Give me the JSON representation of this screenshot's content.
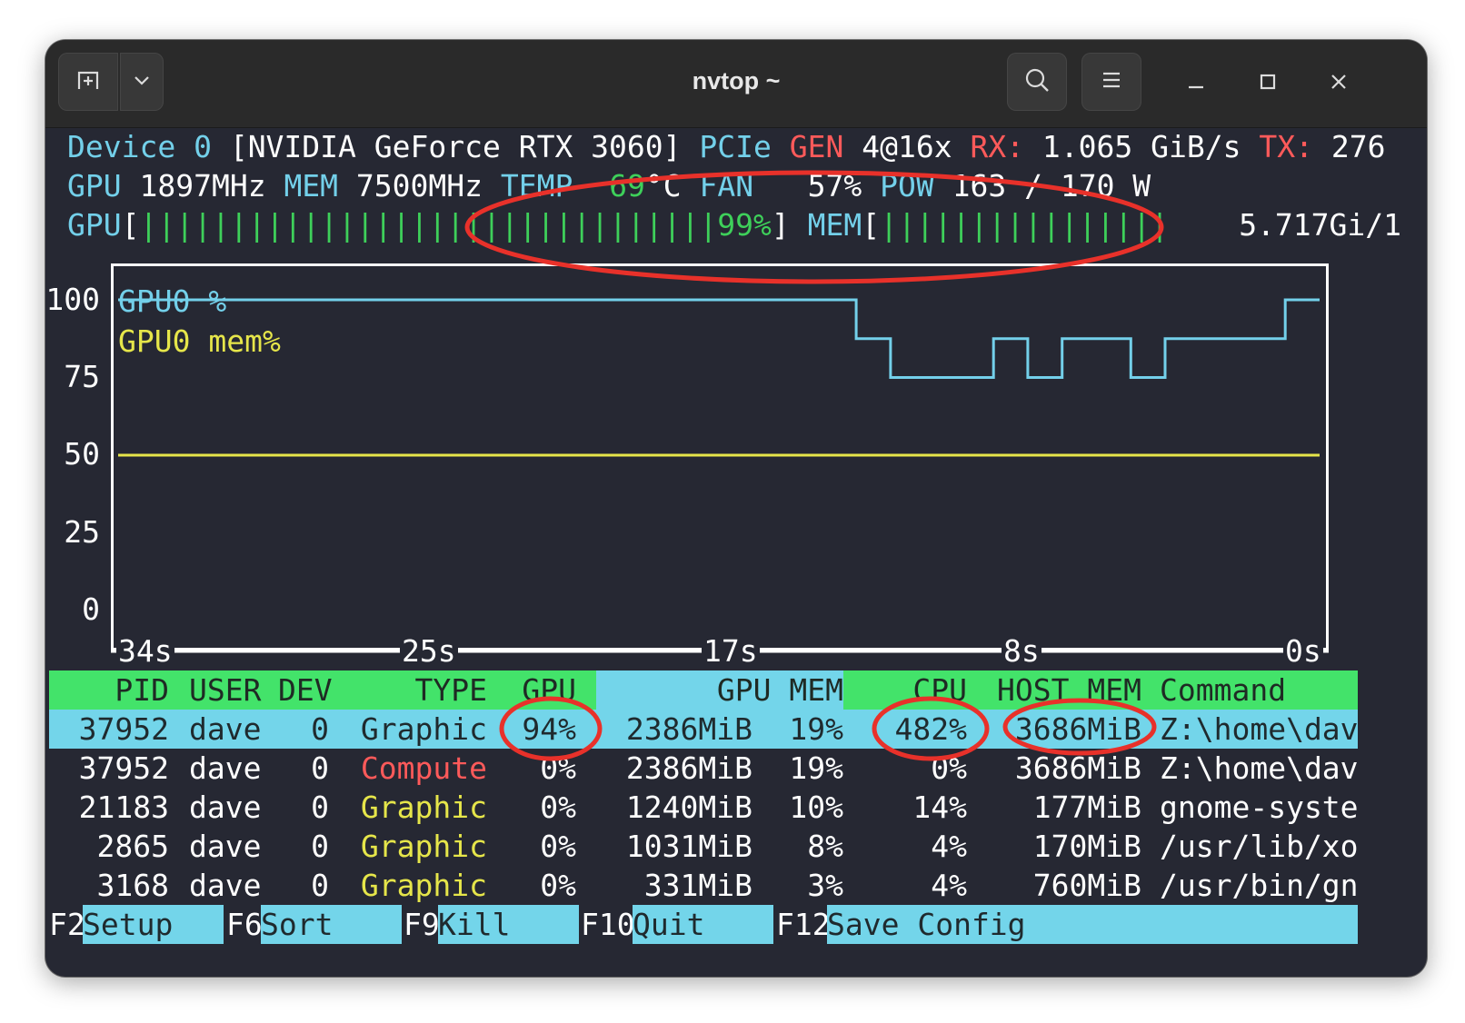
{
  "window": {
    "title": "nvtop ~",
    "new_tab_icon": "new-tab-icon",
    "dropdown_icon": "chevron-down-icon",
    "search_icon": "search-icon",
    "menu_icon": "hamburger-menu-icon",
    "minimize_label": "–",
    "maximize_label": "□",
    "close_label": "×"
  },
  "device": {
    "line1": {
      "device_label": "Device 0",
      "name": " [NVIDIA GeForce RTX 3060] ",
      "pcie_label": "PCIe ",
      "gen_label": "GEN ",
      "gen_value": "4@16x ",
      "rx_label": "RX: ",
      "rx_value": "1.065 GiB/s ",
      "tx_label": "TX: ",
      "tx_value": "276"
    },
    "line2": {
      "gpu_label": "GPU ",
      "gpu_clock": "1897MHz ",
      "mem_label": "MEM ",
      "mem_clock": "7500MHz ",
      "temp_label": "TEMP  ",
      "temp_value": "69",
      "temp_unit": "°C ",
      "fan_label": "FAN  ",
      "fan_value": " 57% ",
      "pow_label": "POW ",
      "pow_value": "163 / 170 W"
    },
    "line3": {
      "gpu_label": "GPU",
      "bracket_open": "[",
      "gpu_bar": "||||||||||||||||||||||||||||||||",
      "gpu_percent": "99%",
      "bracket_close": "]",
      "mem_label": " MEM",
      "mem_bracket_open": "[",
      "mem_bar": "||||||||||||||||",
      "mem_value": "5.717Gi/1"
    },
    "gpu_util_fraction": 0.99
  },
  "chart_data": {
    "type": "line",
    "ylim": [
      0,
      100
    ],
    "y_ticks": [
      "100",
      "75",
      "50",
      "25",
      "0"
    ],
    "x_ticks": [
      "34s",
      "25s",
      "17s",
      "8s",
      "0s"
    ],
    "series": [
      {
        "name": "GPU0 %",
        "color": "#73d0ea",
        "values": [
          100,
          100,
          100,
          100,
          100,
          100,
          100,
          100,
          100,
          100,
          100,
          100,
          100,
          100,
          100,
          100,
          100,
          100,
          100,
          100,
          100,
          100,
          100,
          100,
          100,
          100,
          100,
          100,
          100,
          100,
          100,
          100,
          100,
          100,
          100,
          100,
          100,
          100,
          100,
          100,
          100,
          100,
          100,
          87.5,
          87.5,
          75,
          75,
          75,
          75,
          75,
          75,
          87.5,
          87.5,
          75,
          75,
          87.5,
          87.5,
          87.5,
          87.5,
          75,
          75,
          87.5,
          87.5,
          87.5,
          87.5,
          87.5,
          87.5,
          87.5,
          100,
          100
        ]
      },
      {
        "name": "GPU0 mem%",
        "color": "#e6e64a",
        "values": [
          50,
          50,
          50,
          50,
          50,
          50,
          50,
          50,
          50,
          50,
          50,
          50,
          50,
          50,
          50,
          50,
          50,
          50,
          50,
          50,
          50,
          50,
          50,
          50,
          50,
          50,
          50,
          50,
          50,
          50,
          50,
          50,
          50,
          50,
          50,
          50,
          50,
          50,
          50,
          50,
          50,
          50,
          50,
          50,
          50,
          50,
          50,
          50,
          50,
          50,
          50,
          50,
          50,
          50,
          50,
          50,
          50,
          50,
          50,
          50,
          50,
          50,
          50,
          50,
          50,
          50,
          50,
          50,
          50,
          50
        ]
      }
    ]
  },
  "process_table": {
    "headers": {
      "pid": "PID",
      "user": "USER",
      "dev": "DEV",
      "type": "TYPE",
      "gpu": "GPU",
      "gpu_mem": "GPU MEM",
      "cpu": "CPU",
      "host_mem": "HOST MEM",
      "command": "Command"
    },
    "rows": [
      {
        "pid": "37952",
        "user": "dave",
        "dev": "0",
        "type": "Graphic",
        "gpu": "94%",
        "gpu_mem": "2386MiB",
        "gpu_mem_pct": "19%",
        "cpu": "482%",
        "host_mem": "3686MiB",
        "command": "Z:\\home\\dav"
      },
      {
        "pid": "37952",
        "user": "dave",
        "dev": "0",
        "type": "Compute",
        "gpu": "0%",
        "gpu_mem": "2386MiB",
        "gpu_mem_pct": "19%",
        "cpu": "0%",
        "host_mem": "3686MiB",
        "command": "Z:\\home\\dav"
      },
      {
        "pid": "21183",
        "user": "dave",
        "dev": "0",
        "type": "Graphic",
        "gpu": "0%",
        "gpu_mem": "1240MiB",
        "gpu_mem_pct": "10%",
        "cpu": "14%",
        "host_mem": "177MiB",
        "command": "gnome-syste"
      },
      {
        "pid": "2865",
        "user": "dave",
        "dev": "0",
        "type": "Graphic",
        "gpu": "0%",
        "gpu_mem": "1031MiB",
        "gpu_mem_pct": "8%",
        "cpu": "4%",
        "host_mem": "170MiB",
        "command": "/usr/lib/xo"
      },
      {
        "pid": "3168",
        "user": "dave",
        "dev": "0",
        "type": "Graphic",
        "gpu": "0%",
        "gpu_mem": "331MiB",
        "gpu_mem_pct": "3%",
        "cpu": "4%",
        "host_mem": "760MiB",
        "command": "/usr/bin/gn"
      }
    ]
  },
  "footer": {
    "keys": [
      {
        "key": "F2",
        "label": "Setup"
      },
      {
        "key": "F6",
        "label": "Sort"
      },
      {
        "key": "F9",
        "label": "Kill"
      },
      {
        "key": "F10",
        "label": "Quit"
      },
      {
        "key": "F12",
        "label": "Save Config"
      }
    ]
  },
  "colors": {
    "terminal_bg": "#262833",
    "cyan": "#73d0ea",
    "red": "#ff5a5a",
    "green": "#3ed05a",
    "yellow": "#e6e64a",
    "annotation_red": "#e8312a"
  }
}
